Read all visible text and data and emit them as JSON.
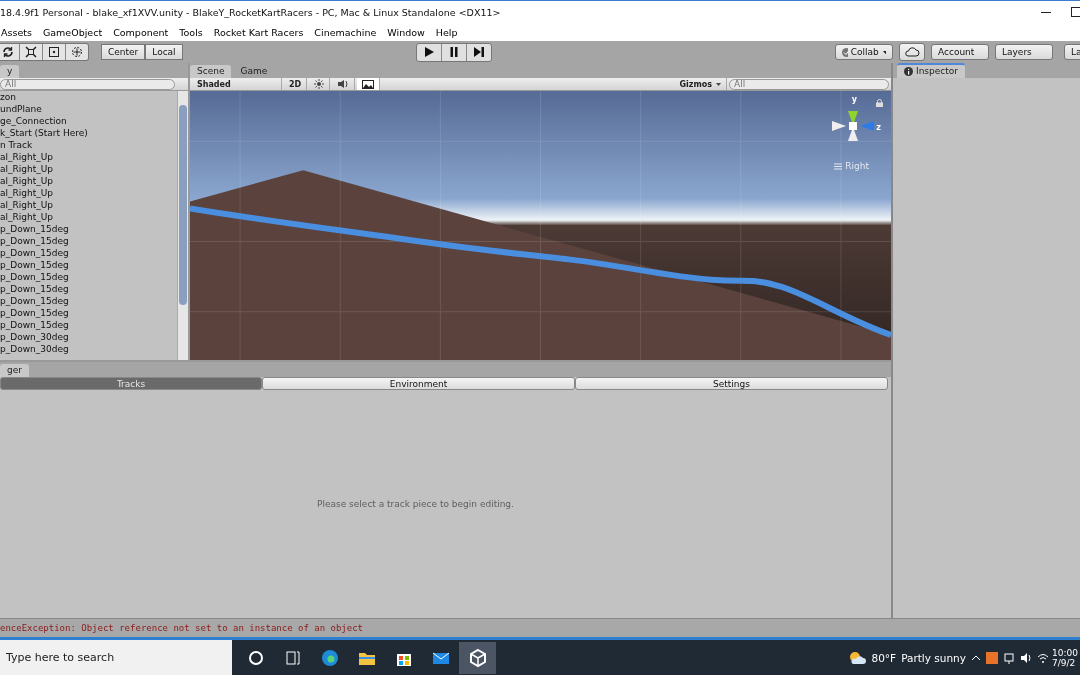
{
  "window": {
    "title": "18.4.9f1 Personal - blake_xf1XVV.unity - BlakeY_RocketKartRacers - PC, Mac & Linux Standalone <DX11>"
  },
  "menu": [
    "Assets",
    "GameObject",
    "Component",
    "Tools",
    "Rocket Kart Racers",
    "Cinemachine",
    "Window",
    "Help"
  ],
  "toolbar": {
    "pivot": "Center",
    "space": "Local",
    "collab": "Collab",
    "account": "Account",
    "layers": "Layers",
    "layout": "La"
  },
  "hierarchy": {
    "tab": "y",
    "search_placeholder": "All",
    "items": [
      "zon",
      "undPlane",
      "ge_Connection",
      "k_Start (Start Here)",
      "n Track",
      "al_Right_Up",
      "al_Right_Up",
      "al_Right_Up",
      "al_Right_Up",
      "al_Right_Up",
      "al_Right_Up",
      "p_Down_15deg",
      "p_Down_15deg",
      "p_Down_15deg",
      "p_Down_15deg",
      "p_Down_15deg",
      "p_Down_15deg",
      "p_Down_15deg",
      "p_Down_15deg",
      "p_Down_15deg",
      "p_Down_30deg",
      "p_Down_30deg"
    ]
  },
  "scene": {
    "tabs": [
      {
        "label": "Scene",
        "selected": true
      },
      {
        "label": "Game",
        "selected": false
      }
    ],
    "shading": "Shaded",
    "mode_2d": "2D",
    "image_effects_on": true,
    "gizmos": "Gizmos",
    "search_placeholder": "All",
    "axis_y": "y",
    "axis_z": "z",
    "view_label": "Right"
  },
  "inspector": {
    "tab": "Inspector"
  },
  "track_manager": {
    "tab": "ger",
    "tabs": [
      {
        "label": "Tracks",
        "selected": true
      },
      {
        "label": "Environment",
        "selected": false
      },
      {
        "label": "Settings",
        "selected": false
      }
    ],
    "message": "Please select a track piece to begin editing."
  },
  "status_bar": {
    "message": "enceException: Object reference not set to an instance of an object"
  },
  "taskbar": {
    "search_placeholder": "Type here to search",
    "apps": [
      {
        "kind": "circle",
        "selected": false
      },
      {
        "kind": "taskview",
        "selected": false
      },
      {
        "kind": "edge",
        "selected": false
      },
      {
        "kind": "folder",
        "selected": false
      },
      {
        "kind": "store",
        "selected": false
      },
      {
        "kind": "mail",
        "selected": false
      },
      {
        "kind": "unity",
        "selected": true
      }
    ],
    "temperature": "80°F",
    "weather": "Partly sunny",
    "time": "10:00",
    "date": "7/9/2"
  }
}
